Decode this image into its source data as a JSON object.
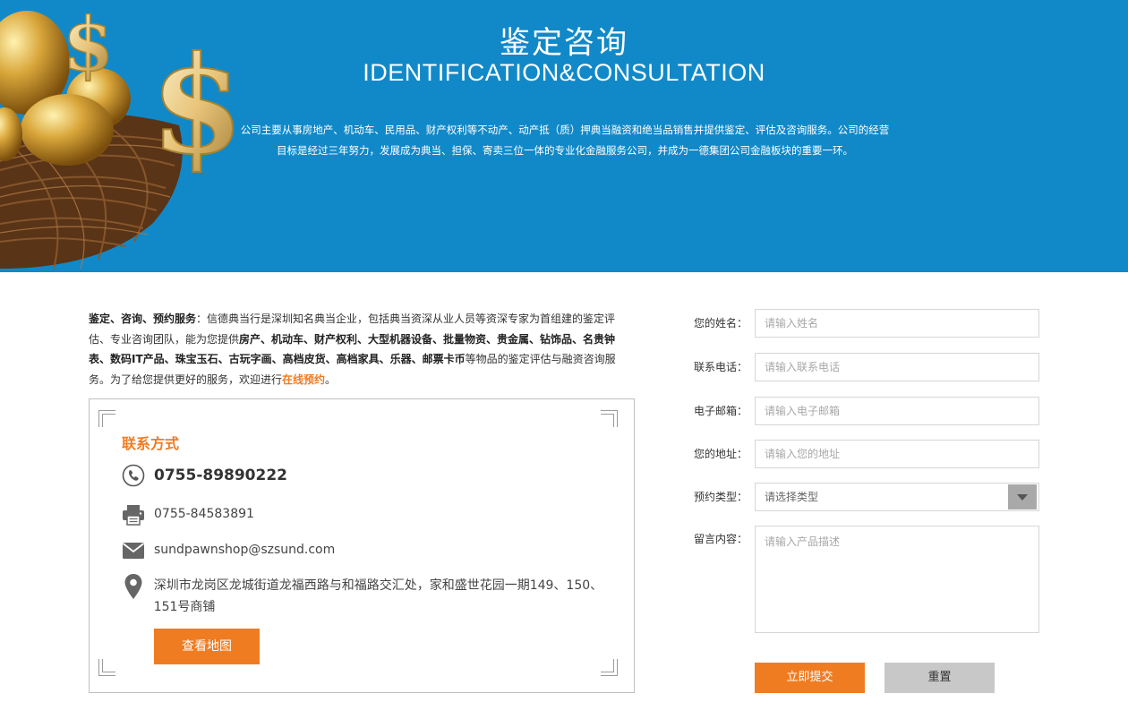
{
  "banner": {
    "title_cn": "鉴定咨询",
    "title_en": "IDENTIFICATION&CONSULTATION",
    "description": "公司主要从事房地产、机动车、民用品、财产权利等不动产、动产抵（质）押典当融资和绝当品销售并提供鉴定、评估及咨询服务。公司的经营目标是经过三年努力，发展成为典当、担保、寄卖三位一体的专业化金融服务公司，并成为一德集团公司金融板块的重要一环。"
  },
  "intro": {
    "lead": "鉴定、咨询、预约服务",
    "text1": "：信德典当行是深圳知名典当企业，包括典当资深从业人员等资深专家为首组建的鉴定评估、专业咨询团队，能为您提供",
    "items": "房产、机动车、财产权利、大型机器设备、批量物资、贵金属、钻饰品、名贵钟表、数码IT产品、珠宝玉石、古玩字画、高档皮货、高档家具、乐器、邮票卡币",
    "text2": "等物品的鉴定评估与融资咨询服务。为了给您提供更好的服务，欢迎进行",
    "link": "在线预约",
    "end": "。"
  },
  "contact": {
    "title": "联系方式",
    "phone": "0755-89890222",
    "fax": "0755-84583891",
    "email": "sundpawnshop@szsund.com",
    "address": "深圳市龙岗区龙城街道龙福西路与和福路交汇处，家和盛世花园一期149、150、151号商铺",
    "map_button": "查看地图"
  },
  "form": {
    "name_label": "您的姓名：",
    "name_placeholder": "请输入姓名",
    "phone_label": "联系电话：",
    "phone_placeholder": "请输入联系电话",
    "email_label": "电子邮箱：",
    "email_placeholder": "请输入电子邮箱",
    "address_label": "您的地址：",
    "address_placeholder": "请输入您的地址",
    "type_label": "预约类型：",
    "type_value": "请选择类型",
    "message_label": "留言内容：",
    "message_placeholder": "请输入产品描述",
    "submit": "立即提交",
    "reset": "重置"
  },
  "colors": {
    "banner_bg": "#1189c8",
    "accent": "#f07c22",
    "reset_bg": "#c8c8c8"
  }
}
